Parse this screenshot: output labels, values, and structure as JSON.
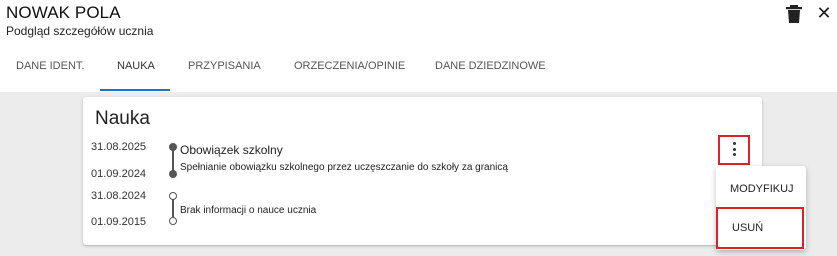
{
  "header": {
    "title": "NOWAK POLA",
    "subtitle": "Podgląd szczegółów ucznia",
    "delete_icon": "trash-icon",
    "close_icon": "close-icon",
    "close_glyph": "✕"
  },
  "tabs": [
    {
      "label": "DANE IDENT."
    },
    {
      "label": "NAUKA",
      "active": true
    },
    {
      "label": "PRZYPISANIA"
    },
    {
      "label": "ORZECZENIA/OPINIE"
    },
    {
      "label": "DANE DZIEDZINOWE"
    }
  ],
  "card": {
    "title": "Nauka",
    "entries": [
      {
        "date_to": "31.08.2025",
        "date_from": "01.09.2024",
        "title": "Obowiązek szkolny",
        "description": "Spełnianie obowiązku szkolnego przez uczęszczanie do szkoły za granicą",
        "marker": "filled"
      },
      {
        "date_to": "31.08.2024",
        "date_from": "01.09.2015",
        "title": "",
        "description": "Brak informacji o nauce ucznia",
        "marker": "open"
      }
    ]
  },
  "menu": {
    "kebab_icon": "more-vertical-icon",
    "items": [
      {
        "label": "MODYFIKUJ"
      },
      {
        "label": "USUŃ"
      }
    ]
  },
  "colors": {
    "accent": "#1a73c8",
    "highlight": "#d9252a"
  }
}
